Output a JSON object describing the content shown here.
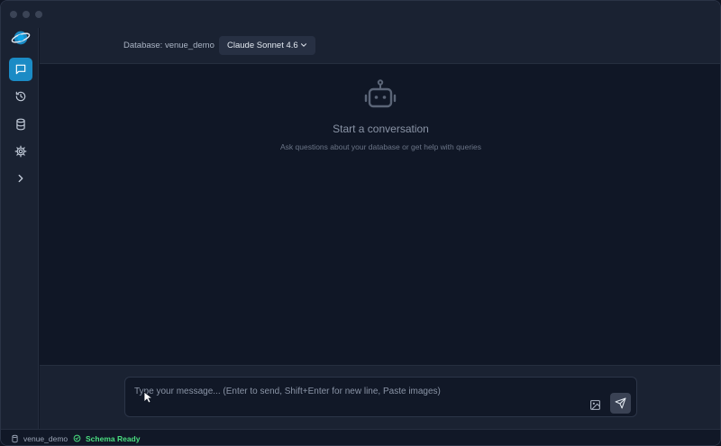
{
  "header": {
    "database_label": "Database: venue_demo",
    "model_selector": "Claude Sonnet 4.6"
  },
  "sidebar": {
    "items": [
      {
        "name": "chat",
        "icon": "chat-icon",
        "active": true
      },
      {
        "name": "history",
        "icon": "history-icon",
        "active": false
      },
      {
        "name": "database",
        "icon": "database-icon",
        "active": false
      },
      {
        "name": "settings",
        "icon": "gear-icon",
        "active": false
      },
      {
        "name": "expand",
        "icon": "chevron-right-icon",
        "active": false
      }
    ]
  },
  "main": {
    "empty_title": "Start a conversation",
    "empty_subtitle": "Ask questions about your database or get help with queries"
  },
  "composer": {
    "placeholder": "Type your message... (Enter to send, Shift+Enter for new line, Paste images)"
  },
  "status": {
    "database": "venue_demo",
    "schema": "Schema Ready"
  },
  "colors": {
    "accent": "#1b8bc5",
    "success": "#4ade80"
  }
}
